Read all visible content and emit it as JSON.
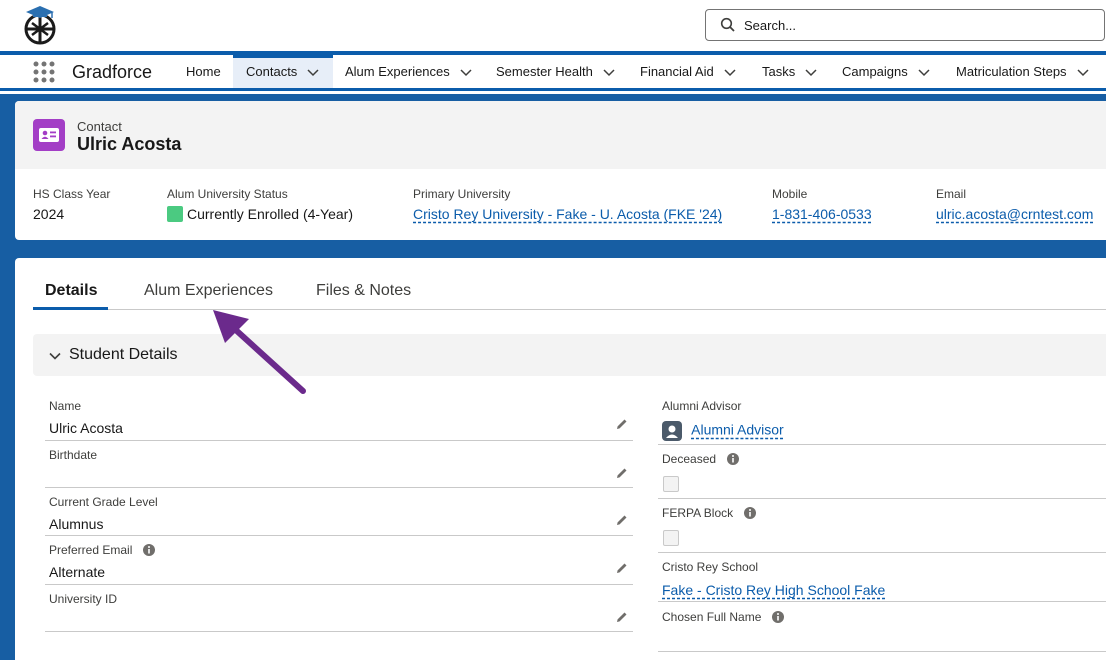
{
  "header": {
    "search_placeholder": "Search..."
  },
  "nav": {
    "app_name": "Gradforce",
    "items": [
      {
        "label": "Home"
      },
      {
        "label": "Contacts"
      },
      {
        "label": "Alum Experiences"
      },
      {
        "label": "Semester Health"
      },
      {
        "label": "Financial Aid"
      },
      {
        "label": "Tasks"
      },
      {
        "label": "Campaigns"
      },
      {
        "label": "Matriculation Steps"
      }
    ]
  },
  "record": {
    "object_label": "Contact",
    "name": "Ulric Acosta",
    "highlights": [
      {
        "label": "HS Class Year",
        "value": "2024"
      },
      {
        "label": "Alum University Status",
        "value": "Currently Enrolled (4-Year)"
      },
      {
        "label": "Primary University",
        "value": "Cristo Rey University - Fake - U. Acosta (FKE '24)"
      },
      {
        "label": "Mobile",
        "value": "1-831-406-0533"
      },
      {
        "label": "Email",
        "value": "ulric.acosta@crntest.com"
      }
    ]
  },
  "tabs": [
    {
      "label": "Details"
    },
    {
      "label": "Alum Experiences"
    },
    {
      "label": "Files & Notes"
    }
  ],
  "section": {
    "title": "Student Details"
  },
  "left_fields": [
    {
      "label": "Name",
      "value": "Ulric Acosta"
    },
    {
      "label": "Birthdate",
      "value": ""
    },
    {
      "label": "Current Grade Level",
      "value": "Alumnus"
    },
    {
      "label": "Preferred Email",
      "value": "Alternate"
    },
    {
      "label": "University ID",
      "value": ""
    }
  ],
  "right_fields": [
    {
      "label": "Alumni Advisor",
      "value": "Alumni Advisor"
    },
    {
      "label": "Deceased",
      "value": ""
    },
    {
      "label": "FERPA Block",
      "value": ""
    },
    {
      "label": "Cristo Rey School",
      "value": "Fake - Cristo Rey High School Fake"
    },
    {
      "label": "Chosen Full Name",
      "value": ""
    }
  ],
  "colors": {
    "brand_blue": "#0b5cab",
    "background_blue": "#175ea3",
    "contact_icon": "#a33ec6",
    "status_green": "#4bca81",
    "annotation_arrow": "#6b2a8c"
  }
}
